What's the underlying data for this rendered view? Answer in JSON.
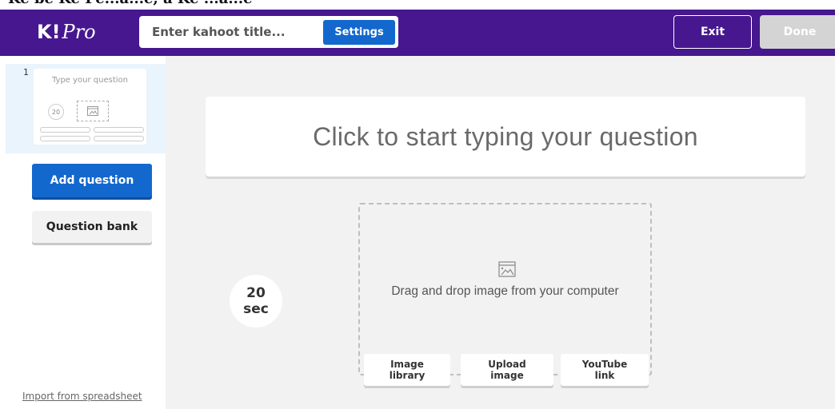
{
  "header": {
    "cutoff_text": "Ke bē Ke Pe...a...e, a Ke ...a...e",
    "logo_k": "K!",
    "logo_pro": "Pro",
    "title_placeholder": "Enter kahoot title...",
    "settings_label": "Settings",
    "exit_label": "Exit",
    "done_label": "Done"
  },
  "sidebar": {
    "slide_number": "1",
    "thumb_question": "Type your question",
    "thumb_timer": "20",
    "add_question_label": "Add question",
    "question_bank_label": "Question bank",
    "import_link": "Import from spreadsheet"
  },
  "editor": {
    "question_placeholder": "Click to start typing your question",
    "timer_value": "20",
    "timer_unit": "sec",
    "media_text": "Drag and drop image from your computer",
    "media_buttons": [
      "Image library",
      "Upload image",
      "YouTube link"
    ]
  },
  "colors": {
    "header_bg": "#46178f",
    "primary_blue": "#1368ce",
    "done_disabled": "#d4d4d4",
    "selected_slide_bg": "#eaf4fc"
  }
}
